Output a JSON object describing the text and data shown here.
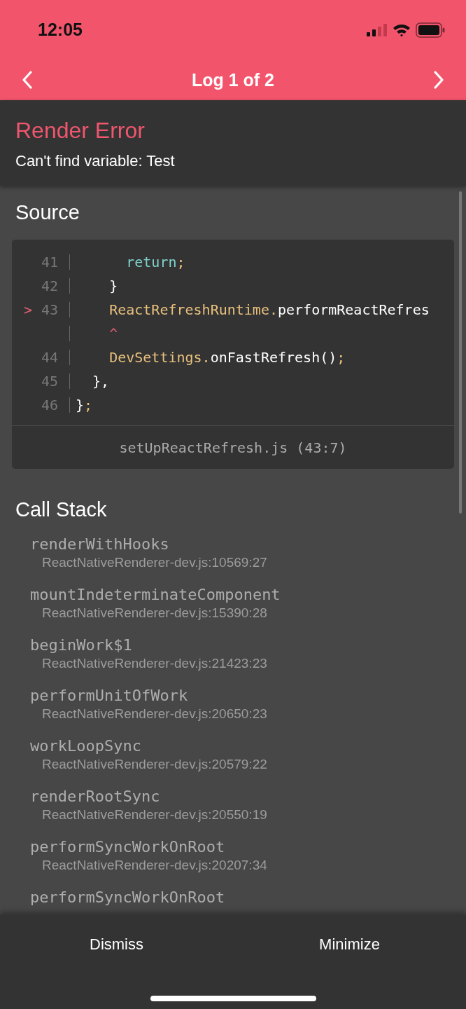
{
  "status_bar": {
    "time": "12:05"
  },
  "header": {
    "title": "Log 1 of 2"
  },
  "error": {
    "title": "Render Error",
    "message": "Can't find variable: Test"
  },
  "source": {
    "heading": "Source",
    "file": "setUpReactRefresh.js (43:7)",
    "lines": [
      {
        "number": "41",
        "tokens": [
          {
            "kind": "keyword",
            "text": "      return"
          },
          {
            "kind": "punct",
            "text": ";"
          }
        ]
      },
      {
        "number": "42",
        "tokens": [
          {
            "kind": "plain",
            "text": "    }"
          }
        ]
      },
      {
        "number": "43",
        "marker": ">",
        "tokens": [
          {
            "kind": "ident",
            "text": "    ReactRefreshRuntime."
          },
          {
            "kind": "plain",
            "text": "performReactRefres"
          }
        ]
      },
      {
        "tokens": [
          {
            "kind": "caret",
            "text": "    ^"
          }
        ]
      },
      {
        "number": "44",
        "tokens": [
          {
            "kind": "ident",
            "text": "    DevSettings."
          },
          {
            "kind": "plain",
            "text": "onFastRefresh()"
          },
          {
            "kind": "punct",
            "text": ";"
          }
        ]
      },
      {
        "number": "45",
        "tokens": [
          {
            "kind": "plain",
            "text": "  },"
          }
        ]
      },
      {
        "number": "46",
        "tokens": [
          {
            "kind": "plain",
            "text": "}"
          },
          {
            "kind": "punct",
            "text": ";"
          }
        ]
      }
    ]
  },
  "call_stack": {
    "heading": "Call Stack",
    "frames": [
      {
        "name": "renderWithHooks",
        "location": "ReactNativeRenderer-dev.js:10569:27"
      },
      {
        "name": "mountIndeterminateComponent",
        "location": "ReactNativeRenderer-dev.js:15390:28"
      },
      {
        "name": "beginWork$1",
        "location": "ReactNativeRenderer-dev.js:21423:23"
      },
      {
        "name": "performUnitOfWork",
        "location": "ReactNativeRenderer-dev.js:20650:23"
      },
      {
        "name": "workLoopSync",
        "location": "ReactNativeRenderer-dev.js:20579:22"
      },
      {
        "name": "renderRootSync",
        "location": "ReactNativeRenderer-dev.js:20550:19"
      },
      {
        "name": "performSyncWorkOnRoot",
        "location": "ReactNativeRenderer-dev.js:20207:34"
      },
      {
        "name": "performSyncWorkOnRoot"
      }
    ]
  },
  "footer": {
    "buttons": [
      "Dismiss",
      "Minimize"
    ]
  }
}
